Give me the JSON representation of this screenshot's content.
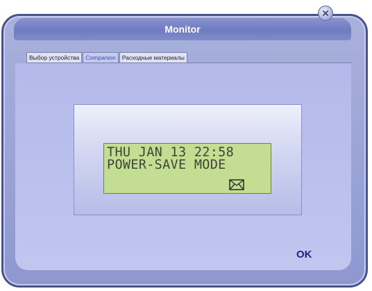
{
  "window": {
    "title": "Monitor"
  },
  "tabs": [
    {
      "label": "Выбор устройства",
      "active": false
    },
    {
      "label": "Companion",
      "active": true
    },
    {
      "label": "Расходные материалы",
      "active": false
    }
  ],
  "lcd": {
    "line1": "THU JAN 13 22:58",
    "line2": "POWER-SAVE MODE",
    "icon": "envelope-icon",
    "background_color": "#c3de93"
  },
  "buttons": {
    "ok_label": "OK"
  },
  "colors": {
    "accent": "#3c4cc0",
    "window": "#8e98cf"
  }
}
